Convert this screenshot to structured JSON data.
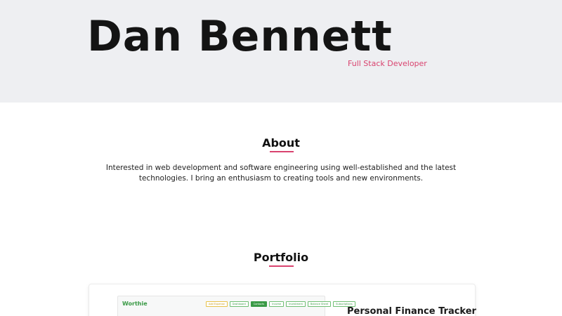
{
  "hero": {
    "name": "Dan Bennett",
    "role": "Full Stack Developer"
  },
  "about": {
    "title": "About",
    "text_line1": "Interested in web development and software engineering using well-established and the latest",
    "text_line2": "technologies. I bring an enthusiasm to creating tools and new environments."
  },
  "portfolio": {
    "title": "Portfolio",
    "project": {
      "title": "Personal Finance Tracker",
      "screenshot": {
        "brand": "Worthie",
        "tabs": [
          "Add Expense",
          "Dashboard",
          "Contacts",
          "Income",
          "Investment",
          "Balance Sheet",
          "Subscriptions"
        ],
        "active_tab_index": 2
      }
    }
  },
  "colors": {
    "accent": "#d9436f",
    "hero_bg": "#eeeff2",
    "brand_green": "#3a9a46"
  }
}
